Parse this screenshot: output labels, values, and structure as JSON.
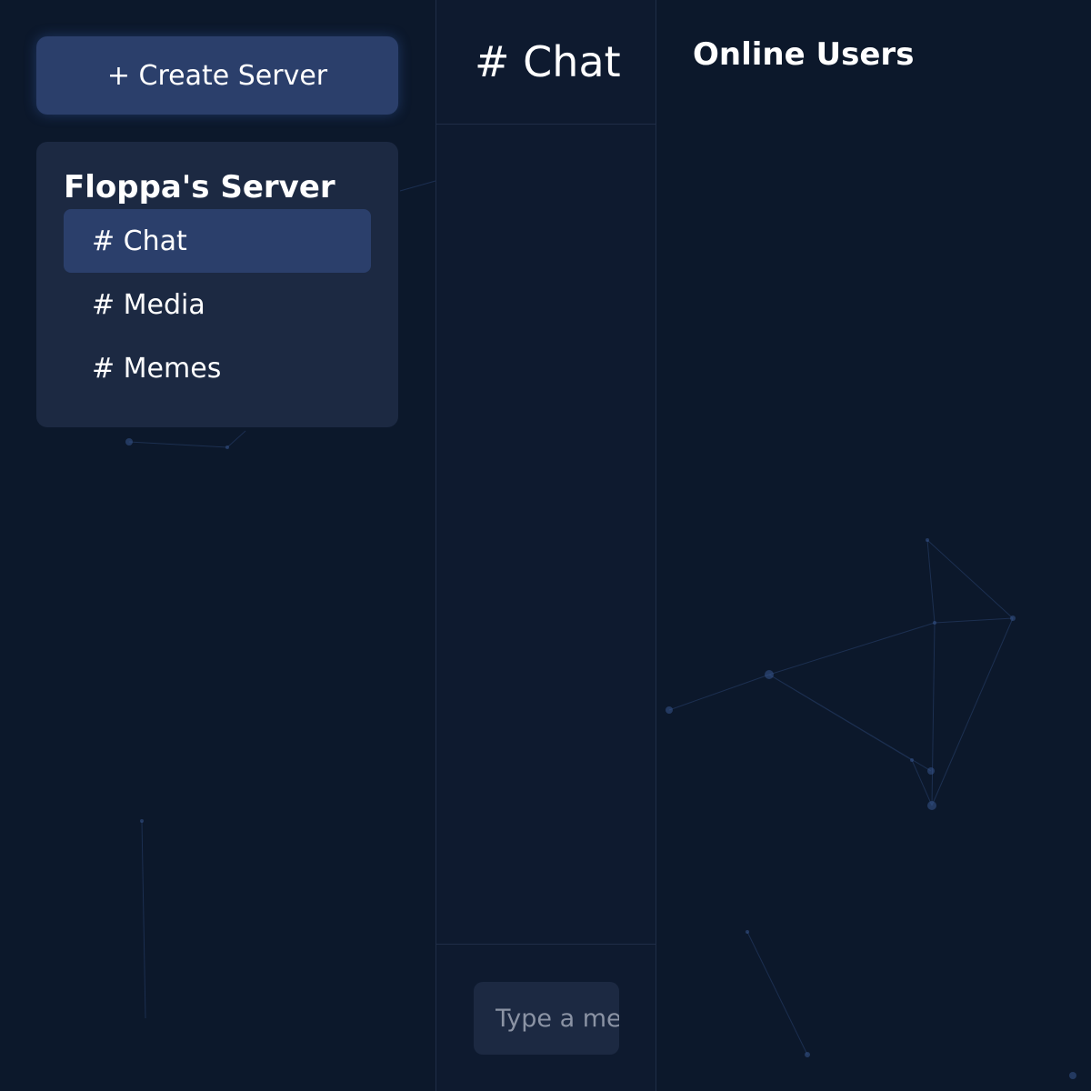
{
  "sidebar": {
    "create_button_label": "+ Create Server",
    "server": {
      "name": "Floppa's Server",
      "channels": [
        {
          "label": "# Chat",
          "active": true
        },
        {
          "label": "# Media",
          "active": false
        },
        {
          "label": "# Memes",
          "active": false
        }
      ]
    }
  },
  "chat": {
    "header_title": "# Chat",
    "input": {
      "value": "",
      "placeholder": "Type a message..."
    }
  },
  "users_panel": {
    "title": "Online Users"
  },
  "colors": {
    "background": "#0c182b",
    "panel": "#1c2942",
    "accent": "#2b3f6b",
    "divider": "#1f2d47",
    "placeholder_text": "#8b93a4"
  }
}
